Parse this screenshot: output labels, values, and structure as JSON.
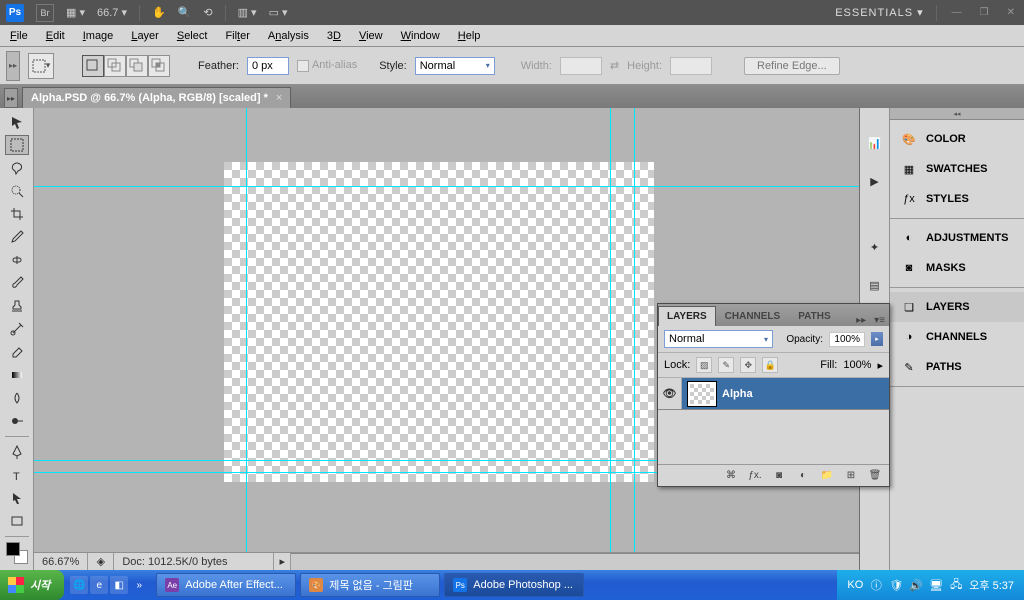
{
  "appbar": {
    "ps": "Ps",
    "br": "Br",
    "zoom": "66.7 ▾",
    "workspace": "ESSENTIALS ▾"
  },
  "menubar": [
    "File",
    "Edit",
    "Image",
    "Layer",
    "Select",
    "Filter",
    "Analysis",
    "3D",
    "View",
    "Window",
    "Help"
  ],
  "optionsbar": {
    "feather_label": "Feather:",
    "feather_value": "0 px",
    "antialias": "Anti-alias",
    "style_label": "Style:",
    "style_value": "Normal",
    "width_label": "Width:",
    "height_label": "Height:",
    "refine": "Refine Edge..."
  },
  "doctab": {
    "title": "Alpha.PSD @ 66.7% (Alpha, RGB/8) [scaled] *"
  },
  "status": {
    "zoom": "66.67%",
    "doc": "Doc: 1012.5K/0 bytes"
  },
  "panels": {
    "items": [
      {
        "icon": "color",
        "label": "COLOR"
      },
      {
        "icon": "swatches",
        "label": "SWATCHES"
      },
      {
        "icon": "styles",
        "label": "STYLES"
      },
      {
        "icon": "adjustments",
        "label": "ADJUSTMENTS"
      },
      {
        "icon": "masks",
        "label": "MASKS"
      },
      {
        "icon": "layers",
        "label": "LAYERS"
      },
      {
        "icon": "channels",
        "label": "CHANNELS"
      },
      {
        "icon": "paths",
        "label": "PATHS"
      }
    ]
  },
  "layers_panel": {
    "tabs": [
      "LAYERS",
      "CHANNELS",
      "PATHS"
    ],
    "blend": "Normal",
    "opacity_label": "Opacity:",
    "opacity": "100%",
    "lock_label": "Lock:",
    "fill_label": "Fill:",
    "fill": "100%",
    "layer_name": "Alpha"
  },
  "taskbar": {
    "start": "시작",
    "tasks": [
      {
        "icon": "Ae",
        "label": "Adobe After Effect..."
      },
      {
        "icon": "🎨",
        "label": "제목 없음 - 그림판"
      },
      {
        "icon": "Ps",
        "label": "Adobe Photoshop ..."
      }
    ],
    "tray_text": "KO",
    "time": "오후 5:37"
  }
}
